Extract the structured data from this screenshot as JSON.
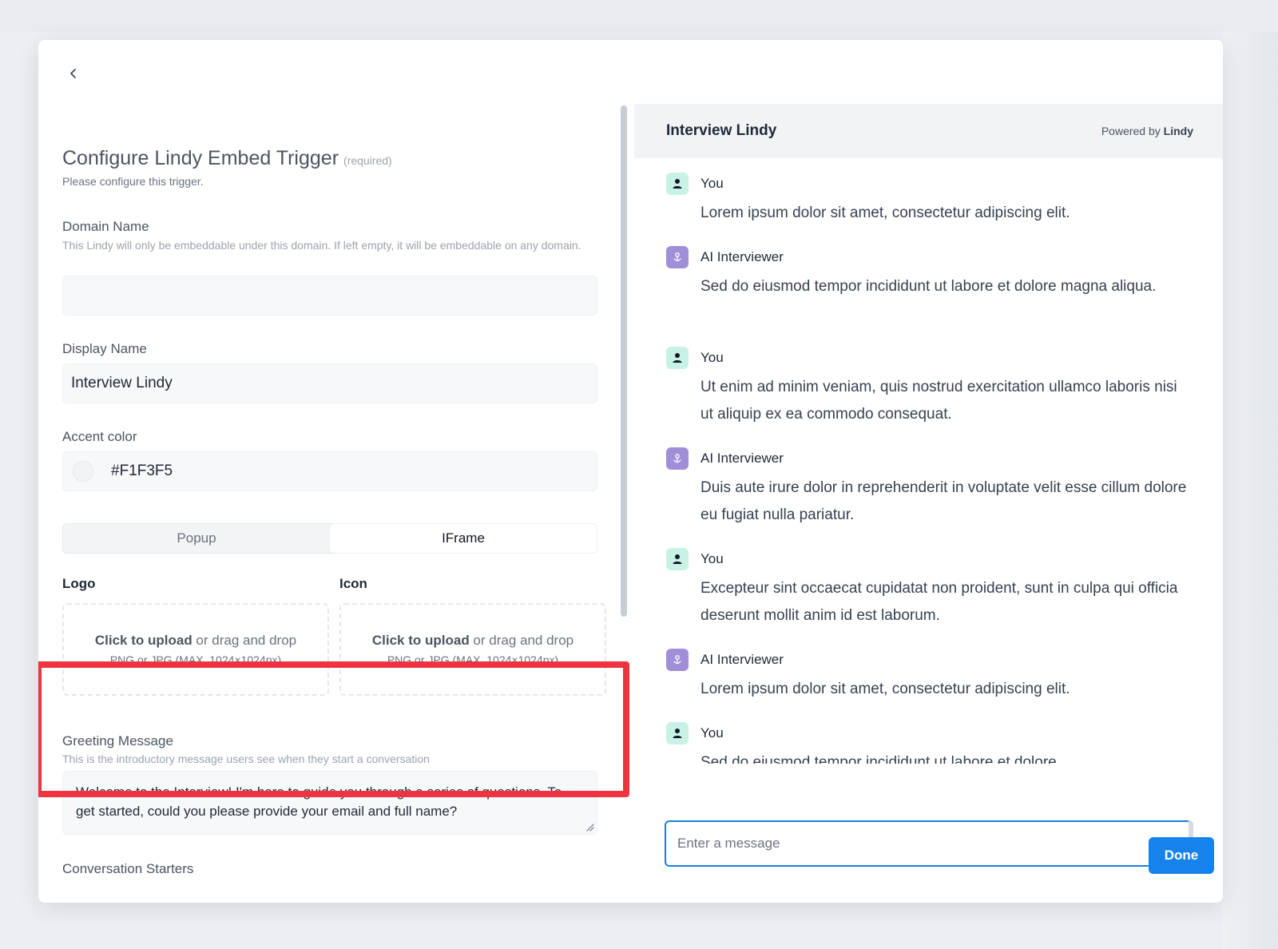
{
  "left": {
    "title": "Configure Lindy Embed Trigger",
    "required": "(required)",
    "subtitle": "Please configure this trigger.",
    "domain": {
      "label": "Domain Name",
      "help": "This Lindy will only be embeddable under this domain. If left empty, it will be embeddable on any domain.",
      "value": ""
    },
    "display": {
      "label": "Display Name",
      "value": "Interview Lindy"
    },
    "accent": {
      "label": "Accent color",
      "value": "#F1F3F5"
    },
    "mode": {
      "options": [
        "Popup",
        "IFrame"
      ],
      "selected": "IFrame"
    },
    "logo": {
      "label": "Logo",
      "upload_bold": "Click to upload",
      "upload_rest": " or drag and drop",
      "upload_hint": "PNG or JPG (MAX. 1024×1024px)"
    },
    "icon": {
      "label": "Icon",
      "upload_bold": "Click to upload",
      "upload_rest": " or drag and drop",
      "upload_hint": "PNG or JPG (MAX. 1024×1024px)"
    },
    "greeting": {
      "label": "Greeting Message",
      "help": "This is the introductory message users see when they start a conversation",
      "value": "Welcome to the Interview! I'm here to guide you through a series of questions. To get started, could you please provide your email and full name?"
    },
    "starters_label": "Conversation Starters"
  },
  "chat": {
    "title": "Interview Lindy",
    "powered_prefix": "Powered by ",
    "powered_brand": "Lindy",
    "messages": [
      {
        "author": "You",
        "role": "user",
        "text": "Lorem ipsum dolor sit amet, consectetur adipiscing elit."
      },
      {
        "author": "AI Interviewer",
        "role": "ai",
        "text": "Sed do eiusmod tempor incididunt ut labore et dolore magna aliqua."
      },
      {
        "author": "You",
        "role": "user",
        "text": "Ut enim ad minim veniam, quis nostrud exercitation ullamco laboris nisi ut aliquip ex ea commodo consequat."
      },
      {
        "author": "AI Interviewer",
        "role": "ai",
        "text": "Duis aute irure dolor in reprehenderit in voluptate velit esse cillum dolore eu fugiat nulla pariatur."
      },
      {
        "author": "You",
        "role": "user",
        "text": "Excepteur sint occaecat cupidatat non proident, sunt in culpa qui officia deserunt mollit anim id est laborum."
      },
      {
        "author": "AI Interviewer",
        "role": "ai",
        "text": "Lorem ipsum dolor sit amet, consectetur adipiscing elit."
      },
      {
        "author": "You",
        "role": "user",
        "text": "Sed do eiusmod tempor incididunt ut labore et dolore"
      }
    ],
    "input_placeholder": "Enter a message"
  },
  "footer": {
    "done_label": "Done"
  },
  "colors": {
    "accent": "#1583eb",
    "highlight": "#ef3340"
  }
}
